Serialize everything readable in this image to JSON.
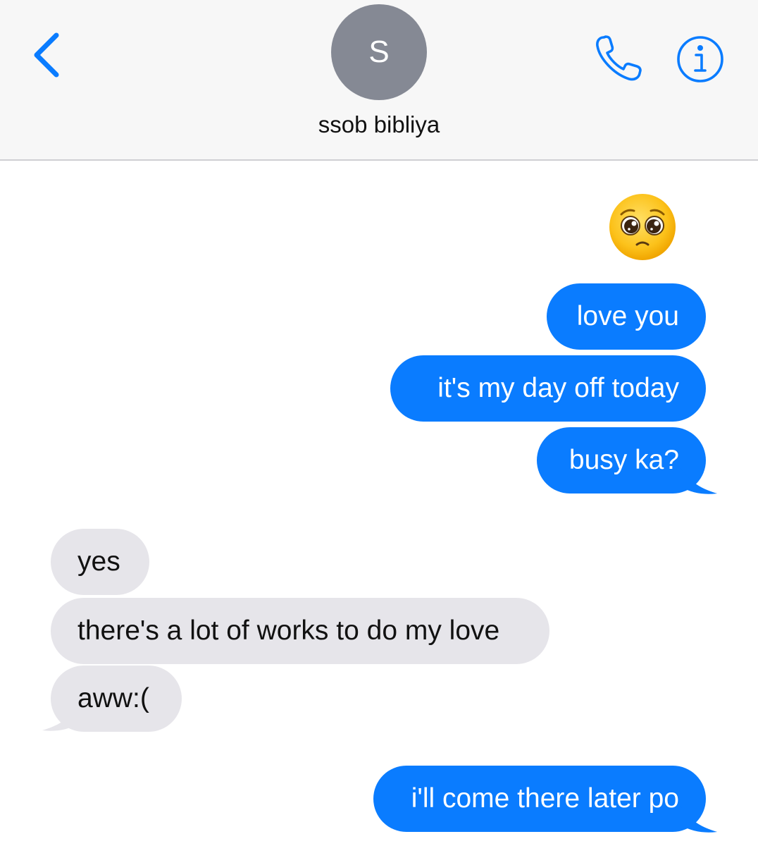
{
  "header": {
    "avatar_initial": "S",
    "contact_name": "ssob bibliya"
  },
  "messages": [
    {
      "from": "me",
      "type": "emoji",
      "emoji": "pleading-face-emoji"
    },
    {
      "from": "me",
      "text": "love you"
    },
    {
      "from": "me",
      "text": "it's my day off today"
    },
    {
      "from": "me",
      "text": "busy ka?"
    },
    {
      "from": "them",
      "text": "yes"
    },
    {
      "from": "them",
      "text": "there's a lot of works to do my love"
    },
    {
      "from": "them",
      "text": "aww:("
    },
    {
      "from": "me",
      "text": "i'll come there later po"
    }
  ],
  "colors": {
    "accent": "#0a7cff",
    "received_bubble": "#e6e5ea",
    "avatar": "#858994",
    "header_bg": "#f7f7f7"
  },
  "icons": [
    "chevron-left-icon",
    "phone-icon",
    "info-icon"
  ]
}
